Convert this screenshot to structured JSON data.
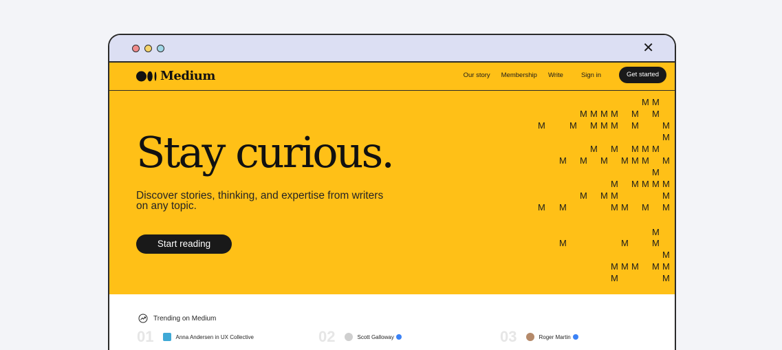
{
  "browser": {
    "close_icon_glyph": "✕"
  },
  "nav": {
    "logo_text": "Medium",
    "links": [
      "Our story",
      "Membership",
      "Write"
    ],
    "signin": "Sign in",
    "get_started": "Get started"
  },
  "hero": {
    "headline": "Stay curious.",
    "subline": "Discover stories, thinking, and expertise from writers on any topic.",
    "cta": "Start reading",
    "pattern_letter": "M"
  },
  "trending": {
    "title": "Trending on Medium",
    "items": [
      {
        "num": "01",
        "author": "Anna Andersen",
        "in": " in ",
        "publication": "UX Collective",
        "verified": false
      },
      {
        "num": "02",
        "author": "Scott Galloway",
        "verified": true
      },
      {
        "num": "03",
        "author": "Roger Martin",
        "verified": true
      }
    ]
  },
  "colors": {
    "brand_yellow": "#ffc017",
    "dark": "#191919"
  }
}
